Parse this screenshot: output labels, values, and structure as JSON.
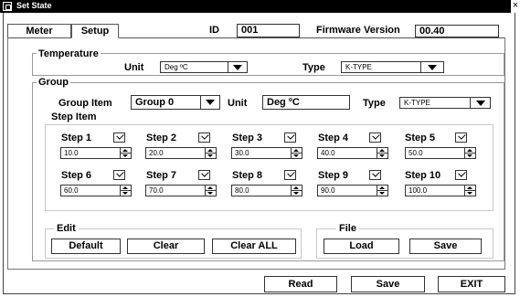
{
  "window": {
    "title": "Set State",
    "close": "×"
  },
  "tabs": [
    {
      "label": "Meter"
    },
    {
      "label": "Setup"
    }
  ],
  "header": {
    "id_label": "ID",
    "id_value": "001",
    "fw_label": "Firmware Version",
    "fw_value": "00.40"
  },
  "temperature": {
    "heading": "Temperature",
    "unit_label": "Unit",
    "unit_value": "Deg ºC",
    "type_label": "Type",
    "type_value": "K-TYPE"
  },
  "group": {
    "heading": "Group",
    "item_label": "Group Item",
    "item_value": "Group 0",
    "unit_label": "Unit",
    "unit_value": "Deg ºC",
    "type_label": "Type",
    "type_value": "K-TYPE",
    "step_item_label": "Step Item"
  },
  "steps": [
    {
      "label": "Step 1",
      "value": "10.0"
    },
    {
      "label": "Step 2",
      "value": "20.0"
    },
    {
      "label": "Step 3",
      "value": "30.0"
    },
    {
      "label": "Step 4",
      "value": "40.0"
    },
    {
      "label": "Step 5",
      "value": "50.0"
    },
    {
      "label": "Step 6",
      "value": "60.0"
    },
    {
      "label": "Step 7",
      "value": "70.0"
    },
    {
      "label": "Step 8",
      "value": "80.0"
    },
    {
      "label": "Step 9",
      "value": "90.0"
    },
    {
      "label": "Step 10",
      "value": "100.0"
    }
  ],
  "edit": {
    "heading": "Edit",
    "default": "Default",
    "clear": "Clear",
    "clear_all": "Clear ALL"
  },
  "file": {
    "heading": "File",
    "load": "Load",
    "save": "Save"
  },
  "footer": {
    "read": "Read",
    "save": "Save",
    "exit": "EXIT"
  }
}
